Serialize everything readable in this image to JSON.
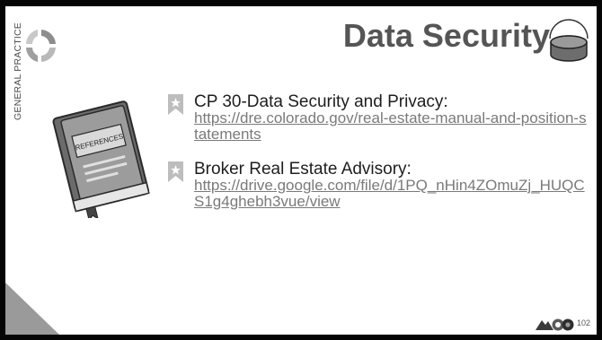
{
  "slide": {
    "side_label": "GENERAL PRACTICE",
    "title": "Data Security",
    "book_label": "REFERENCES",
    "page_number": "102"
  },
  "references": [
    {
      "title": "CP 30-Data Security and Privacy:",
      "link": "https://dre.colorado.gov/real-estate-manual-and-position-statements"
    },
    {
      "title": "Broker Real Estate Advisory:",
      "link": "https://drive.google.com/file/d/1PQ_nHin4ZOmuZj_HUQCS1g4ghebh3vue/view"
    }
  ],
  "colors": {
    "background": "#050505",
    "slide": "#ffffff",
    "title": "#555555",
    "link": "#7a7a7a"
  },
  "icons": [
    "circular-arrows-icon",
    "database-icon",
    "book-icon",
    "bookmark-bullet-icon",
    "colorado-logo-icon"
  ]
}
